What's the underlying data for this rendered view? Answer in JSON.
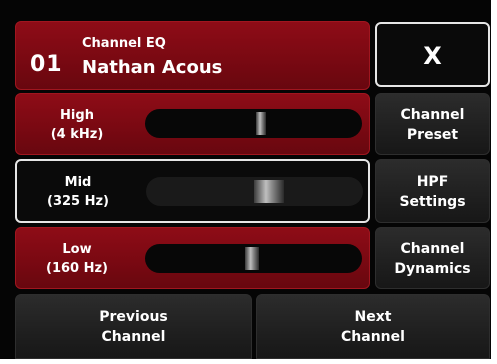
{
  "header": {
    "channel_number": "01",
    "title": "Channel EQ",
    "channel_name": "Nathan Acous",
    "close_label": "X"
  },
  "bands": [
    {
      "name": "High",
      "freq": "(4 kHz)",
      "gain_position": 0.55
    },
    {
      "name": "Mid",
      "freq": "(325 Hz)",
      "gain_position": 0.58
    },
    {
      "name": "Low",
      "freq": "(160 Hz)",
      "gain_position": 0.5
    }
  ],
  "side_buttons": {
    "channel_preset": [
      "Channel",
      "Preset"
    ],
    "hpf_settings": [
      "HPF",
      "Settings"
    ],
    "channel_dynamics": [
      "Channel",
      "Dynamics"
    ]
  },
  "bottom": {
    "previous": [
      "Previous",
      "Channel"
    ],
    "next": [
      "Next",
      "Channel"
    ]
  },
  "colors": {
    "background": "#050505",
    "accent_red": "#7a0912",
    "button_dark": "#1f1f1f",
    "selected_border": "#e6e6e6",
    "text": "#ffffff"
  }
}
